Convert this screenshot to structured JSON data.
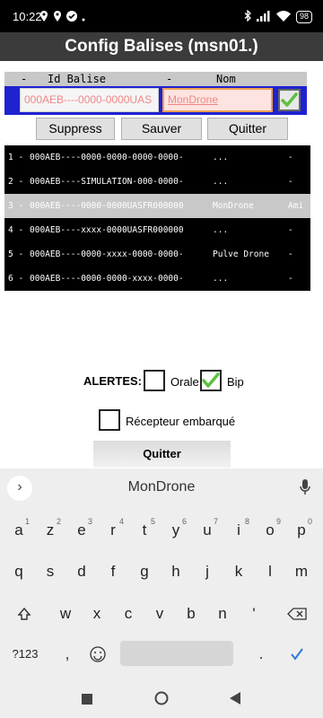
{
  "status_bar": {
    "time": "10:22",
    "battery": "98"
  },
  "title_bar": {
    "title": "Config Balises (msn01.)"
  },
  "header": {
    "col1": "-",
    "col2": "Id Balise",
    "col3": "-",
    "col4": "Nom"
  },
  "edit": {
    "id_value": "000AEB----0000-0000UAS",
    "name_value": "MonDrone",
    "confirm_checked": true
  },
  "buttons": {
    "delete": "Suppress",
    "save": "Sauver",
    "quit": "Quitter"
  },
  "list": {
    "rows": [
      {
        "index": "1 -",
        "id": "000AEB----0000-0000-0000-0000-",
        "name": "...",
        "extra": "-",
        "selected": false
      },
      {
        "index": "2 -",
        "id": "000AEB----SIMULATION-000-0000-",
        "name": "...",
        "extra": "-",
        "selected": false
      },
      {
        "index": "3 -",
        "id": "000AEB----0000-0000UASFR000000",
        "name": "MonDrone",
        "extra": "Ami",
        "selected": true
      },
      {
        "index": "4 -",
        "id": "000AEB----xxxx-0000UASFR000000",
        "name": "...",
        "extra": "-",
        "selected": false
      },
      {
        "index": "5 -",
        "id": "000AEB----0000-xxxx-0000-0000-",
        "name": "Pulve Drone",
        "extra": "-",
        "selected": false
      },
      {
        "index": "6 -",
        "id": "000AEB----0000-0000-xxxx-0000-",
        "name": "...",
        "extra": "-",
        "selected": false
      }
    ]
  },
  "alerts": {
    "label": "ALERTES:",
    "oral_label": "Orale",
    "oral_checked": false,
    "bip_label": "Bip",
    "bip_checked": true,
    "receiver_label": "Récepteur embarqué",
    "receiver_checked": false
  },
  "quit_bottom": "Quitter",
  "keyboard": {
    "suggestion": "MonDrone",
    "row1": [
      {
        "k": "a",
        "h": "1"
      },
      {
        "k": "z",
        "h": "2"
      },
      {
        "k": "e",
        "h": "3"
      },
      {
        "k": "r",
        "h": "4"
      },
      {
        "k": "t",
        "h": "5"
      },
      {
        "k": "y",
        "h": "6"
      },
      {
        "k": "u",
        "h": "7"
      },
      {
        "k": "i",
        "h": "8"
      },
      {
        "k": "o",
        "h": "9"
      },
      {
        "k": "p",
        "h": "0"
      }
    ],
    "row2": [
      "q",
      "s",
      "d",
      "f",
      "g",
      "h",
      "j",
      "k",
      "l",
      "m"
    ],
    "row3": [
      "w",
      "x",
      "c",
      "v",
      "b",
      "n",
      "'"
    ],
    "symbols_key": "?123",
    "comma_key": ","
  },
  "colors": {
    "title_bg": "#3b3b3b",
    "edit_row_bg": "#1e22d0",
    "list_bg": "#000000",
    "selected_row_bg": "#c8c8c8",
    "check_green": "#5cc040",
    "enter_blue": "#2a7bd4"
  }
}
